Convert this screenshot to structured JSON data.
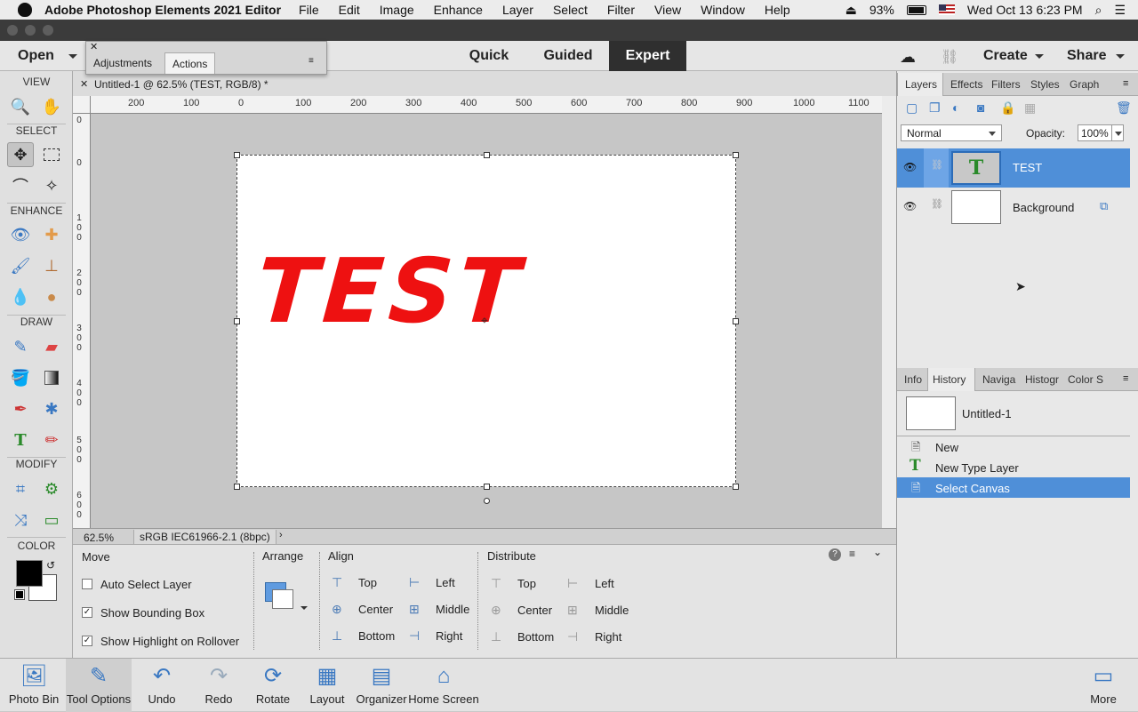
{
  "menubar": {
    "app_name": "Adobe Photoshop Elements 2021 Editor",
    "items": [
      "File",
      "Edit",
      "Image",
      "Enhance",
      "Layer",
      "Select",
      "Filter",
      "View",
      "Window",
      "Help"
    ],
    "battery": "93%",
    "datetime": "Wed Oct 13  6:23 PM"
  },
  "modebar": {
    "open": "Open",
    "modes": [
      "Quick",
      "Guided",
      "Expert"
    ],
    "active_mode": "Expert",
    "create": "Create",
    "share": "Share"
  },
  "float_panel": {
    "tabs": [
      "Adjustments",
      "Actions"
    ],
    "selected": "Actions"
  },
  "toolbox": {
    "sections": [
      "VIEW",
      "SELECT",
      "ENHANCE",
      "DRAW",
      "MODIFY",
      "COLOR"
    ],
    "fg_color": "#000000",
    "bg_color": "#ffffff"
  },
  "document": {
    "tab_title": "Untitled-1 @ 62.5% (TEST, RGB/8) *",
    "text_layer_content": "TEST",
    "text_color": "#ee1111",
    "ruler_h": [
      "200",
      "100",
      "0",
      "100",
      "200",
      "300",
      "400",
      "500",
      "600",
      "700",
      "800",
      "900",
      "1000",
      "1100"
    ],
    "ruler_v": [
      "0",
      "0",
      "100",
      "200",
      "300",
      "400",
      "500",
      "600"
    ]
  },
  "statusbar": {
    "zoom": "62.5%",
    "profile": "sRGB IEC61966-2.1 (8bpc)"
  },
  "tool_options": {
    "move_label": "Move",
    "arrange_label": "Arrange",
    "align_label": "Align",
    "distribute_label": "Distribute",
    "checkboxes": [
      {
        "label": "Auto Select Layer",
        "checked": false
      },
      {
        "label": "Show Bounding Box",
        "checked": true
      },
      {
        "label": "Show Highlight on Rollover",
        "checked": true
      }
    ],
    "align": {
      "col1": [
        "Top",
        "Center",
        "Bottom"
      ],
      "col2": [
        "Left",
        "Middle",
        "Right"
      ]
    },
    "distribute": {
      "col1": [
        "Top",
        "Center",
        "Bottom"
      ],
      "col2": [
        "Left",
        "Middle",
        "Right"
      ]
    }
  },
  "layers_panel": {
    "tabs": [
      "Layers",
      "Effects",
      "Filters",
      "Styles",
      "Graphi"
    ],
    "selected_tab": "Layers",
    "blend_mode": "Normal",
    "opacity_label": "Opacity:",
    "opacity_value": "100%",
    "layers": [
      {
        "name": "TEST",
        "selected": true
      },
      {
        "name": "Background",
        "selected": false
      }
    ]
  },
  "history_panel": {
    "tabs": [
      "Info",
      "History",
      "Naviga",
      "Histogr",
      "Color S"
    ],
    "selected_tab": "History",
    "snapshot": "Untitled-1",
    "items": [
      {
        "label": "New",
        "selected": false
      },
      {
        "label": "New Type Layer",
        "selected": false
      },
      {
        "label": "Select Canvas",
        "selected": true
      }
    ]
  },
  "taskbar": {
    "buttons": [
      "Photo Bin",
      "Tool Options",
      "Undo",
      "Redo",
      "Rotate",
      "Layout",
      "Organizer",
      "Home Screen"
    ],
    "more": "More"
  }
}
